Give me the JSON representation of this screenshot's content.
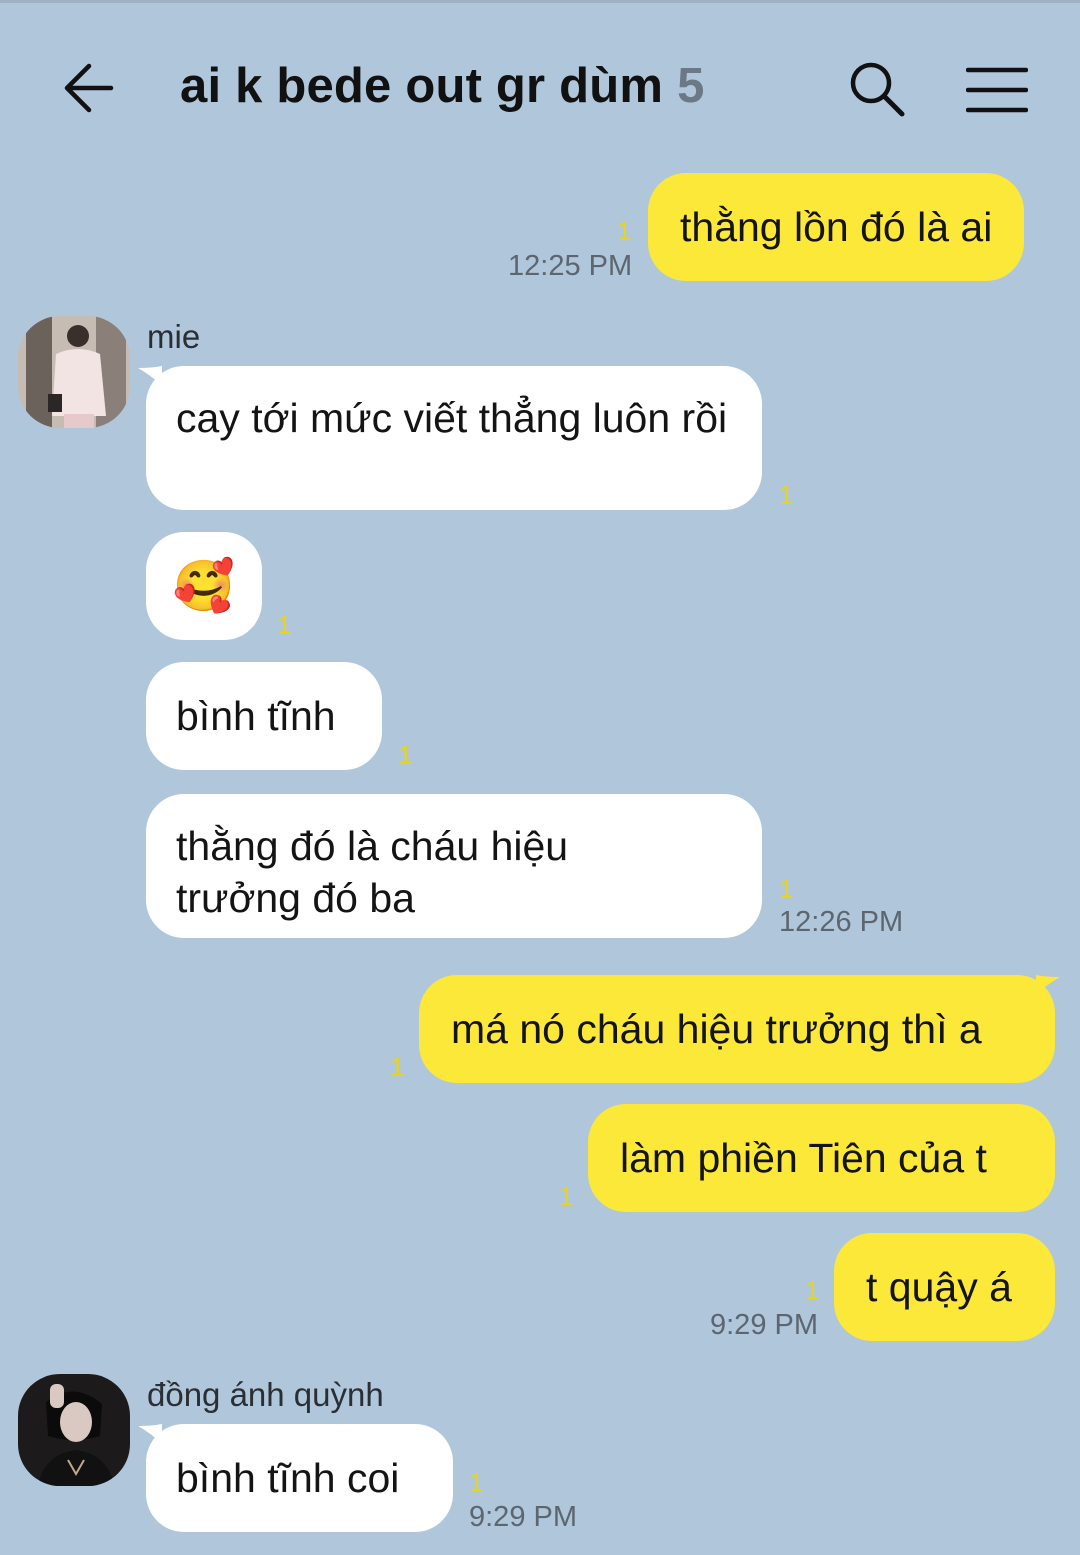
{
  "header": {
    "title": "ai k bede out gr dùm",
    "member_count": "5",
    "back_icon": "arrow-left-icon",
    "search_icon": "search-icon",
    "menu_icon": "hamburger-menu-icon"
  },
  "colors": {
    "background": "#b0c6db",
    "my_bubble": "#fbe839",
    "their_bubble": "#ffffff",
    "unread": "#e8d41a"
  },
  "messages": [
    {
      "from": "me",
      "text": "thằng lồn đó là ai",
      "unread": "1",
      "time": "12:25 PM"
    },
    {
      "from": "mie",
      "sender": "mie",
      "text": "cay tới mức viết thẳng luôn rồi",
      "unread": "1"
    },
    {
      "from": "mie",
      "text": "🥰",
      "unread": "1"
    },
    {
      "from": "mie",
      "text": "bình tĩnh",
      "unread": "1"
    },
    {
      "from": "mie",
      "text": "thằng đó là cháu hiệu trưởng đó ba",
      "unread": "1",
      "time": "12:26 PM"
    },
    {
      "from": "me",
      "text": "má nó cháu hiệu trưởng thì a",
      "unread": "1"
    },
    {
      "from": "me",
      "text": "làm phiền Tiên của t",
      "unread": "1"
    },
    {
      "from": "me",
      "text": "t quậy á",
      "unread": "1",
      "time": "9:29 PM"
    },
    {
      "from": "dong_anh_quynh",
      "sender": "đồng ánh quỳnh",
      "text": "bình tĩnh coi",
      "unread": "1",
      "time": "9:29 PM"
    }
  ]
}
